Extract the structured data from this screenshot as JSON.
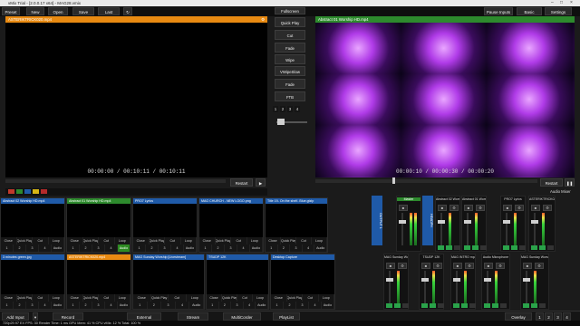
{
  "window": {
    "title": "vMix Trial - [2.0.0.17 x64] - MAG28.vmix"
  },
  "toolbar": {
    "preset": "Preset",
    "new": "New",
    "open": "Open",
    "save": "Save",
    "last": "Last",
    "pause_inputs": "Pause Inputs",
    "basic": "Basic",
    "settings": "Settings"
  },
  "preview": {
    "title": "ASTERIKTRICK020.mp4",
    "time": "00:00:00  /  00:10:11  /  00:10:11",
    "restart": "Restart"
  },
  "program": {
    "title": "Abstract 01 Worship HD.mp4",
    "time": "00:00:10  /  00:00:30  /  00:00:20",
    "restart": "Restart",
    "audio_mixer": "Audio Mixer"
  },
  "transitions": {
    "quick_play": "Quick Play",
    "cut": "Cut",
    "fade": "Fade",
    "wipe": "Wipe",
    "vwipe": "VWipeSlow",
    "fade2": "Fade",
    "ftb": "FTB",
    "numbers": [
      "1",
      "2",
      "3",
      "4"
    ]
  },
  "inputs": [
    {
      "num": "1",
      "name": "Abstract 02 Worship HD.mp4",
      "color": "#1f5aa8"
    },
    {
      "num": "2",
      "name": "Abstract 01 Worship HD.mp4",
      "color": "#2d8a2d"
    },
    {
      "num": "3",
      "name": "PRO7 Lyrics",
      "color": "#1f5aa8"
    },
    {
      "num": "4",
      "name": "MAG CHURCH - NEW LOGO.png",
      "color": "#1f5aa8"
    },
    {
      "num": "5",
      "name": "Title 19- On the shelf- Blue.gtzip",
      "color": "#1f5aa8"
    },
    {
      "num": "6",
      "name": "3 minutes green.jpg",
      "color": "#1f5aa8"
    },
    {
      "num": "7",
      "name": "ASTERIKTRICK020.mp4",
      "color": "#e88a12"
    },
    {
      "num": "8",
      "name": "MAG Sunday Worship [Livestream]",
      "color": "#1f5aa8"
    },
    {
      "num": "10",
      "name": "TSUDP 12K",
      "color": "#1f5aa8"
    },
    {
      "num": "11",
      "name": "Desktop Capture",
      "color": "#1f5aa8"
    }
  ],
  "input_controls": {
    "close": "Close",
    "quick_play": "Quick Play",
    "cut": "Cut",
    "loop": "Loop",
    "audio": "Audio",
    "a": "A",
    "b": "B",
    "numbers": [
      "1",
      "2",
      "3",
      "4"
    ]
  },
  "audio": {
    "master": "Master",
    "output": "OUTPUT 1",
    "headphones": "HEADPH",
    "channels": [
      "Abstract 02 Wors",
      "Abstract 01 Wors",
      "PRO7 Lyrics",
      "ASTERIKTRICK020",
      "MAG Sunday Worsh",
      "TSUDP 12K",
      "MAG INTRO mp4",
      "Audio Microphone",
      "MAG Sunday Worsh"
    ]
  },
  "bottom": {
    "add_input": "Add Input",
    "record": "Record",
    "external": "External",
    "stream": "Stream",
    "multicorder": "MultiCorder",
    "playlist": "PlayList",
    "overlay": "Overlay",
    "overlay_nums": [
      "1",
      "2",
      "3",
      "4"
    ]
  },
  "status": {
    "text": "720p29.97  EX  FPS: 30  Render Time: 1 ms  GPU Mem: 41 %  CPU vMix: 12 %  Total: 100 %"
  }
}
